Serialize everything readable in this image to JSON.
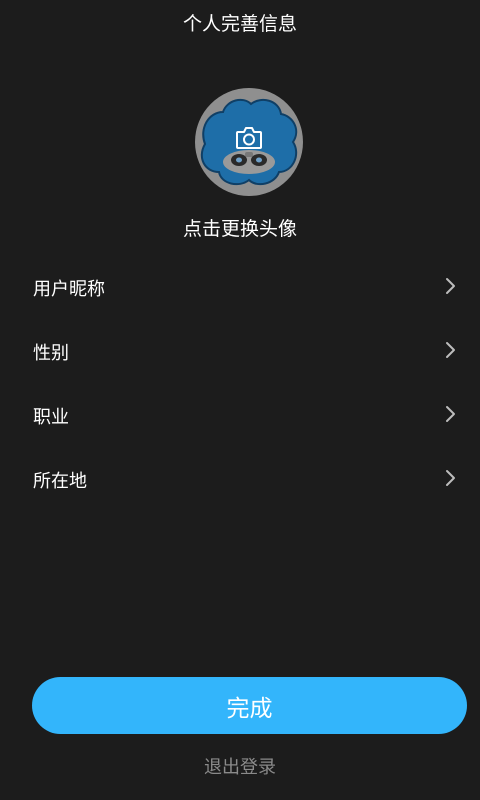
{
  "header": {
    "title": "个人完善信息"
  },
  "avatar": {
    "hint": "点击更换头像",
    "overlay_icon": "camera-icon"
  },
  "settings": {
    "items": [
      {
        "label": "用户昵称",
        "icon": "chevron-right-icon"
      },
      {
        "label": "性别",
        "icon": "chevron-right-icon"
      },
      {
        "label": "职业",
        "icon": "chevron-right-icon"
      },
      {
        "label": "所在地",
        "icon": "chevron-right-icon"
      }
    ]
  },
  "actions": {
    "done_label": "完成",
    "logout_label": "退出登录"
  },
  "colors": {
    "background": "#1c1c1c",
    "accent": "#33b5fb",
    "muted_text": "#8a8a8a"
  }
}
